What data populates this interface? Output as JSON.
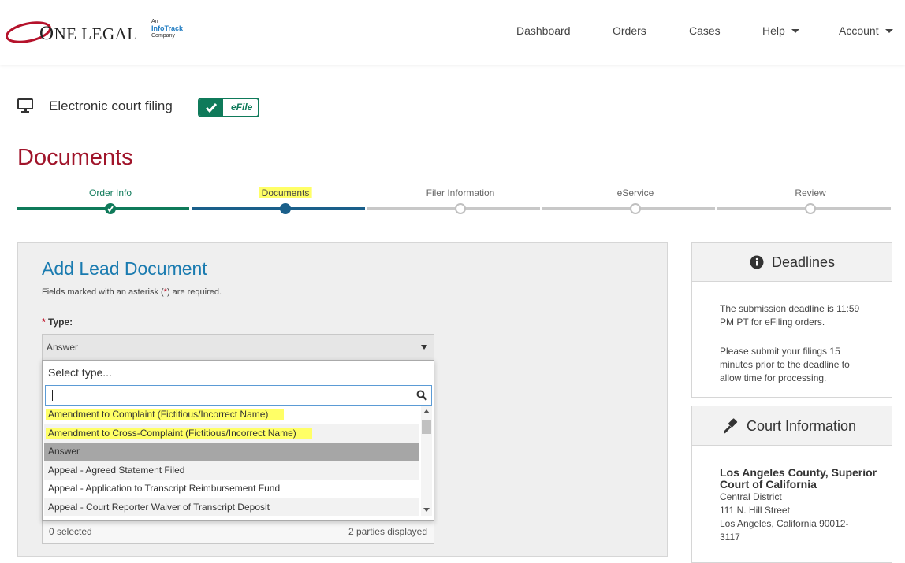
{
  "brand": {
    "logo_main": "NE LEGAL",
    "logo_initial": "O",
    "logo_sub_an": "An",
    "logo_sub_infotrack": "InfoTrack",
    "logo_sub_company": "Company"
  },
  "nav": {
    "dashboard": "Dashboard",
    "orders": "Orders",
    "cases": "Cases",
    "help": "Help",
    "account": "Account"
  },
  "efile": {
    "title": "Electronic court filing",
    "toggle_label": "eFile"
  },
  "page_title": "Documents",
  "steps": [
    {
      "label": "Order Info",
      "state": "done"
    },
    {
      "label": "Documents",
      "state": "active"
    },
    {
      "label": "Filer Information",
      "state": "todo"
    },
    {
      "label": "eService",
      "state": "todo"
    },
    {
      "label": "Review",
      "state": "todo"
    }
  ],
  "form": {
    "heading": "Add Lead Document",
    "required_note_pre": "Fields marked with an asterisk (",
    "required_note_ast": "*",
    "required_note_post": ") are required.",
    "type_ast": "*",
    "type_label": "Type:",
    "type_value": "Answer",
    "footer_left": "0 selected",
    "footer_right": "2 parties displayed"
  },
  "dropdown": {
    "header": "Select type...",
    "search_value": "",
    "items": [
      {
        "label": "Amendment to Complaint (Fictitious/Incorrect Name)",
        "highlight": true
      },
      {
        "label": "Amendment to Cross-Complaint (Fictitious/Incorrect Name)",
        "highlight": true
      },
      {
        "label": "Answer",
        "selected": true
      },
      {
        "label": "Appeal - Agreed Statement Filed"
      },
      {
        "label": "Appeal - Application to Transcript Reimbursement Fund"
      },
      {
        "label": "Appeal - Court Reporter Waiver of Transcript Deposit"
      }
    ]
  },
  "deadlines": {
    "title": "Deadlines",
    "text1": "The submission deadline is 11:59 PM PT for eFiling orders.",
    "text2": "Please submit your filings 15 minutes prior to the deadline to allow time for processing."
  },
  "court": {
    "title": "Court Information",
    "name": "Los Angeles County, Superior Court of California",
    "district": "Central District",
    "street": "111 N. Hill Street",
    "city": "Los Angeles, California 90012-3117"
  },
  "colors": {
    "brand_red": "#a0142a",
    "efile_green": "#0f7a5a",
    "active_blue": "#1a5f8a",
    "heading_blue": "#1a7bb0",
    "highlight_yellow": "#ffff66"
  }
}
